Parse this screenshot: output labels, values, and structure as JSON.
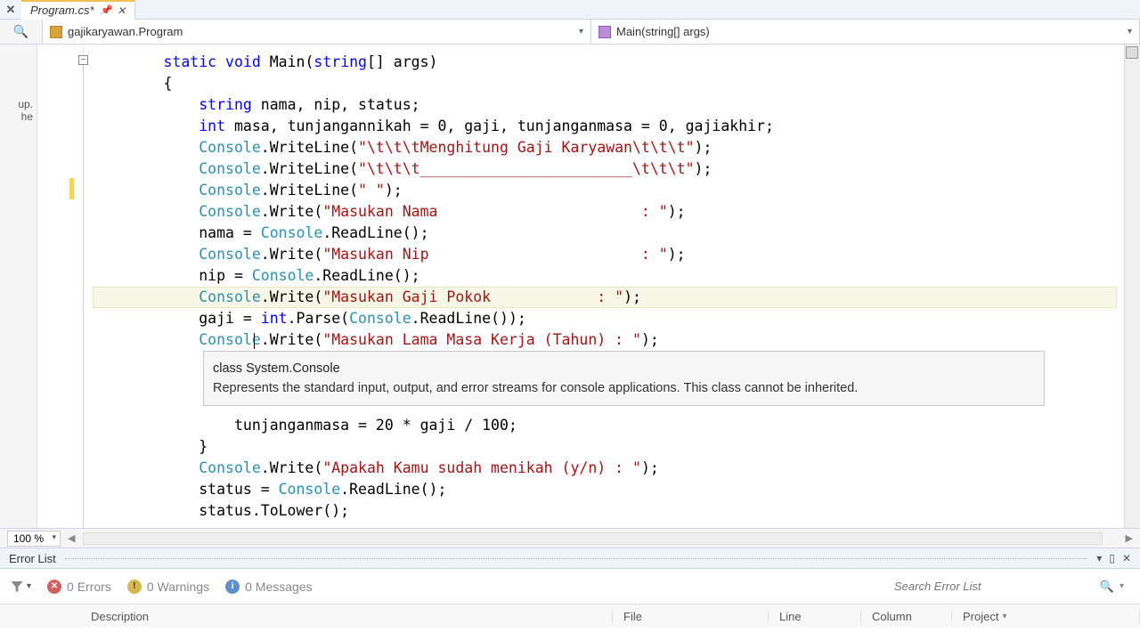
{
  "tab": {
    "filename": "Program.cs*",
    "close_x": "✕"
  },
  "dropdowns": {
    "namespace": "gajikaryawan.Program",
    "method": "Main(string[] args)"
  },
  "side_text": {
    "line1": "up.",
    "line2": "he"
  },
  "code": {
    "l1_a": "static",
    "l1_b": "void",
    "l1_c": " Main(",
    "l1_d": "string",
    "l1_e": "[] args)",
    "l2": "{",
    "l3_a": "string",
    "l3_b": " nama, nip, status;",
    "l4_a": "int",
    "l4_b": " masa, tunjangannikah = 0, gaji, tunjanganmasa = 0, gajiakhir;",
    "l5_a": "Console",
    "l5_b": ".WriteLine(",
    "l5_c": "\"\\t\\t\\tMenghitung Gaji Karyawan\\t\\t\\t\"",
    "l5_d": ");",
    "l6_a": "Console",
    "l6_b": ".WriteLine(",
    "l6_c": "\"\\t\\t\\t________________________\\t\\t\\t\"",
    "l6_d": ");",
    "l7_a": "Console",
    "l7_b": ".WriteLine(",
    "l7_c": "\" \"",
    "l7_d": ");",
    "l8_a": "Console",
    "l8_b": ".Write(",
    "l8_c": "\"Masukan Nama                       : \"",
    "l8_d": ");",
    "l9_a": "nama = ",
    "l9_b": "Console",
    "l9_c": ".ReadLine();",
    "l10_a": "Console",
    "l10_b": ".Write(",
    "l10_c": "\"Masukan Nip                        : \"",
    "l10_d": ");",
    "l11_a": "nip = ",
    "l11_b": "Console",
    "l11_c": ".ReadLine();",
    "l12_a": "Console",
    "l12_b": ".Write(",
    "l12_c": "\"Masukan Gaji Pokok            : \"",
    "l12_d": ");",
    "l13_a": "gaji = ",
    "l13_b": "int",
    "l13_c": ".Parse(",
    "l13_d": "Console",
    "l13_e": ".ReadLine());",
    "l14_a": "Console",
    "l14_b": ".Write(",
    "l14_c": "\"Masukan Lama Masa Kerja (Tahun) : \"",
    "l14_d": ");",
    "l17": "    tunjanganmasa = 20 * gaji / 100;",
    "l18": "}",
    "l19_a": "Console",
    "l19_b": ".Write(",
    "l19_c": "\"Apakah Kamu sudah menikah (y/n) : \"",
    "l19_d": ");",
    "l20_a": "status = ",
    "l20_b": "Console",
    "l20_c": ".ReadLine();",
    "l21": "status.ToLower();"
  },
  "tooltip": {
    "title": "class System.Console",
    "desc": "Represents the standard input, output, and error streams for console applications. This class cannot be inherited."
  },
  "zoom": "100 %",
  "error_list": {
    "title": "Error List",
    "errors": "0 Errors",
    "warnings": "0 Warnings",
    "messages": "0 Messages",
    "search_placeholder": "Search Error List"
  },
  "columns": {
    "description": "Description",
    "file": "File",
    "line": "Line",
    "column": "Column",
    "project": "Project"
  }
}
